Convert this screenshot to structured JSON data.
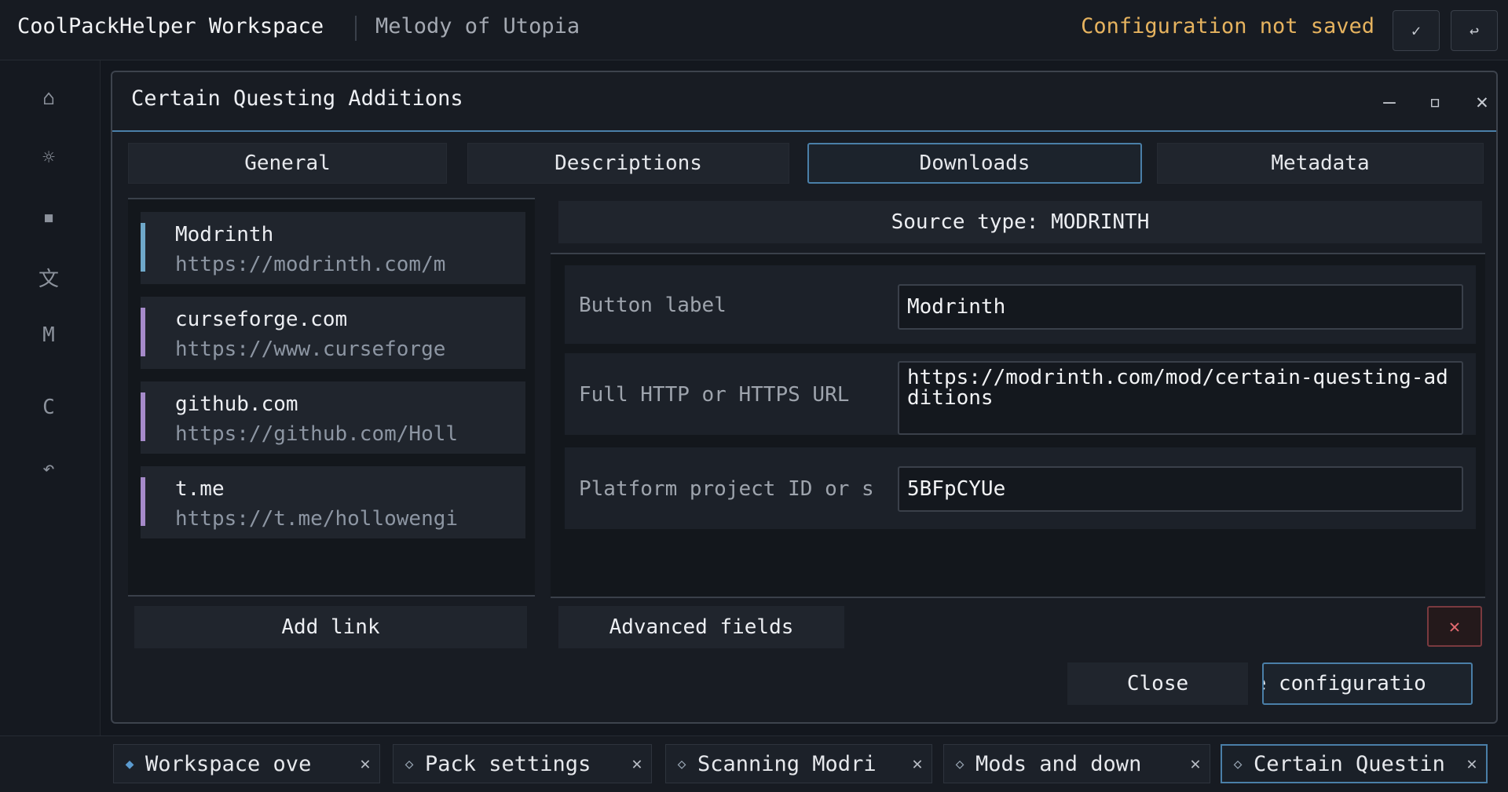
{
  "topbar": {
    "app_title": "CoolPackHelper Workspace",
    "workspace_name": "Melody of Utopia",
    "save_status": "Configuration not saved",
    "apply_icon": "✓",
    "revert_icon": "↩",
    "status_color": "#e6b35f"
  },
  "rail": {
    "icons": [
      {
        "name": "home-icon",
        "glyph": "⌂"
      },
      {
        "name": "settings-icon",
        "glyph": "☼"
      },
      {
        "name": "square-icon",
        "glyph": "▪"
      },
      {
        "name": "translate-icon",
        "glyph": "文"
      },
      {
        "name": "m-icon",
        "glyph": "M"
      },
      {
        "name": "c-icon",
        "glyph": "C"
      },
      {
        "name": "undo-icon",
        "glyph": "↶"
      }
    ]
  },
  "dialog": {
    "title": "Certain Questing Additions",
    "minimize_icon": "—",
    "maximize_icon": "▫",
    "close_icon": "✕",
    "tabs": [
      "General",
      "Descriptions",
      "Downloads",
      "Metadata"
    ],
    "active_tab": "Downloads",
    "links": [
      {
        "name": "Modrinth",
        "url": "https://modrinth.com/m",
        "accent": "#6fa8c9"
      },
      {
        "name": "curseforge.com",
        "url": "https://www.curseforge",
        "accent": "#a58ac9"
      },
      {
        "name": "github.com",
        "url": "https://github.com/Holl",
        "accent": "#a58ac9"
      },
      {
        "name": "t.me",
        "url": "https://t.me/hollowengi",
        "accent": "#a58ac9"
      }
    ],
    "add_link_label": "Add link",
    "source_type": "Source type: MODRINTH",
    "fields": {
      "button_label": {
        "label": "Button label",
        "value": "Modrinth"
      },
      "url": {
        "label": "Full HTTP or HTTPS URL",
        "value": "https://modrinth.com/mod/certain-questing-additions"
      },
      "project_id": {
        "label": "Platform project ID or s",
        "value": "5BFpCYUe"
      }
    },
    "advanced_label": "Advanced fields",
    "remove_icon": "✕",
    "close_label": "Close",
    "save_label": "ve configuratio"
  },
  "bottom_tabs": [
    {
      "label": "Workspace ove",
      "icon": "◆",
      "active": false
    },
    {
      "label": "Pack settings",
      "icon": "◇",
      "active": false
    },
    {
      "label": "Scanning Modri",
      "icon": "◇",
      "active": false
    },
    {
      "label": "Mods and down",
      "icon": "◇",
      "active": false
    },
    {
      "label": "Certain Questin",
      "icon": "◇",
      "active": true
    }
  ],
  "close_tab_icon": "✕",
  "accent_color": "#4a7fa8"
}
